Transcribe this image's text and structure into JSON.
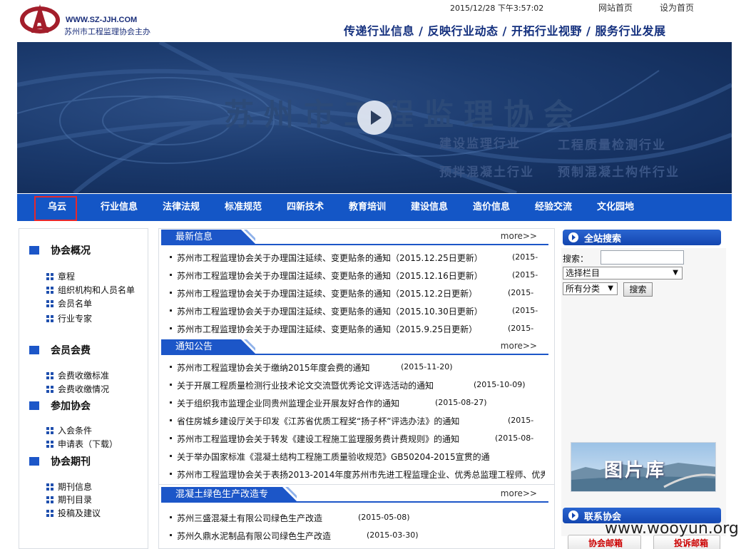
{
  "header": {
    "logo_url": "WWW.SZ-JJH.COM",
    "logo_org": "苏州市工程监理协会主办",
    "datetime": "2015/12/28  下午3:57:02",
    "link_home": "网站首页",
    "link_sethome": "设为首页",
    "slogan": "传递行业信息 / 反映行业动态 / 开拓行业视野 / 服务行业发展"
  },
  "banner": {
    "title": "苏州市工程监理协会",
    "sub1": "建设监理行业",
    "sub2": "工程质量检测行业",
    "sub3": "预拌混凝土行业",
    "sub4": "预制混凝土构件行业"
  },
  "nav": {
    "items": [
      "乌云",
      "行业信息",
      "法律法规",
      "标准规范",
      "四新技术",
      "教育培训",
      "建设信息",
      "造价信息",
      "经验交流",
      "文化园地"
    ]
  },
  "left": {
    "sections": [
      {
        "title": "协会概况",
        "items": [
          "章程",
          "组织机构和人员名单",
          "会员名单",
          "行业专家"
        ]
      },
      {
        "title": "会员会费",
        "items": [
          "会费收缴标准",
          "会费收缴情况"
        ]
      },
      {
        "title": "参加协会",
        "items": [
          "入会条件",
          "申请表（下载）"
        ]
      },
      {
        "title": "协会期刊",
        "items": [
          "期刊信息",
          "期刊目录",
          "投稿及建议"
        ]
      }
    ]
  },
  "center": {
    "more_label": "more>>",
    "news": {
      "title": "最新信息",
      "rows": [
        {
          "text": "苏州市工程监理协会关于办理国注延续、变更贴条的通知（2015.12.25日更新）",
          "date": "(2015-"
        },
        {
          "text": "苏州市工程监理协会关于办理国注延续、变更贴条的通知（2015.12.16日更新）",
          "date": "(2015-"
        },
        {
          "text": "苏州市工程监理协会关于办理国注延续、变更贴条的通知（2015.12.2日更新）",
          "date": "(2015-"
        },
        {
          "text": "苏州市工程监理协会关于办理国注延续、变更贴条的通知（2015.10.30日更新）",
          "date": "(2015-"
        },
        {
          "text": "苏州市工程监理协会关于办理国注延续、变更贴条的通知（2015.9.25日更新）",
          "date": "(2015-"
        }
      ]
    },
    "notice": {
      "title": "通知公告",
      "rows": [
        {
          "text": "苏州市工程监理协会关于缴纳2015年度会费的通知",
          "date": "(2015-11-20)"
        },
        {
          "text": "关于开展工程质量检测行业技术论文交流暨优秀论文评选活动的通知",
          "date": "(2015-10-09)"
        },
        {
          "text": "关于组织我市监理企业同贵州监理企业开展友好合作的通知",
          "date": "(2015-08-27)"
        },
        {
          "text": "省住房城乡建设厅关于印发《江苏省优质工程奖“扬子杯”评选办法》的通知",
          "date": "(2015-"
        },
        {
          "text": "苏州市工程监理协会关于转发《建设工程施工监理服务费计费规则》的通知",
          "date": "(2015-08-"
        },
        {
          "text": "关于举办国家标准《混凝土结构工程施工质量验收规范》GB50204-2015宣贯的通",
          "date": ""
        },
        {
          "text": "苏州市工程监理协会关于表扬2013-2014年度苏州市先进工程监理企业、优秀总监理工程师、优秀",
          "date": ""
        }
      ]
    },
    "green": {
      "title": "混凝土绿色生产改造专栏",
      "rows": [
        {
          "text": "苏州三盛混凝土有限公司绿色生产改造",
          "date": "(2015-05-08)"
        },
        {
          "text": "苏州久鼎水泥制品有限公司绿色生产改造",
          "date": "(2015-03-30)"
        }
      ]
    }
  },
  "right": {
    "search_title": "全站搜索",
    "search_label": "搜索：",
    "column_select": "选择栏目",
    "category_select": "所有分类",
    "search_button": "搜索",
    "gallery_label": "图片库",
    "contact_title": "联系协会",
    "mailbox1": "协会邮箱",
    "mailbox2": "投诉邮箱"
  },
  "watermark": "www.wooyun.org",
  "colors": {
    "nav_blue": "#1456c6",
    "banner_navy": "#1b3a6d",
    "title_blue": "#14307e",
    "highlight_red": "#e8282b"
  }
}
